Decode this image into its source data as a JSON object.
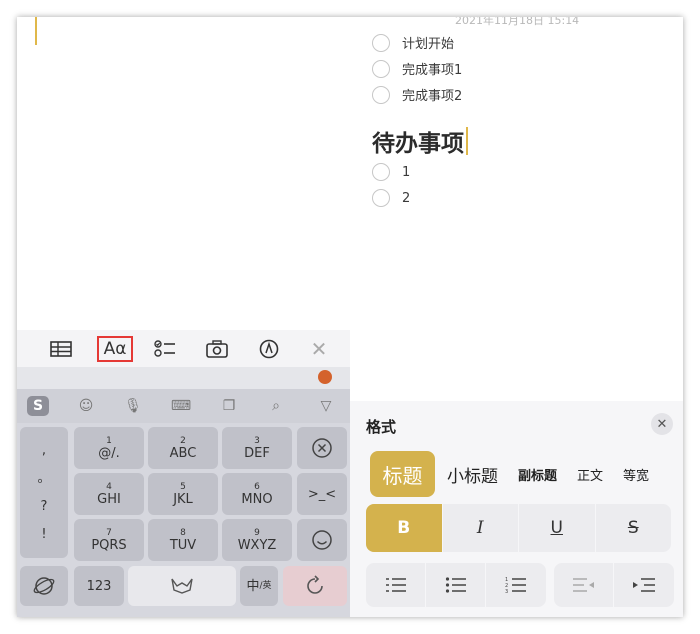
{
  "note": {
    "date": "2021年11月18日 15:14",
    "checklist_top": [
      "计划开始",
      "完成事项1",
      "完成事项2"
    ],
    "heading": "待办事项",
    "checklist_bottom": [
      "1",
      "2"
    ]
  },
  "toolbar": {
    "items": [
      "table-icon",
      "format-icon",
      "checklist-icon",
      "camera-icon",
      "markup-icon",
      "close-icon"
    ],
    "format_label": "Aα",
    "close_label": "✕"
  },
  "keyboard": {
    "left_col": [
      ",",
      "。",
      "?",
      "!"
    ],
    "keys": [
      {
        "top": "1",
        "main": "@/."
      },
      {
        "top": "2",
        "main": "ABC"
      },
      {
        "top": "3",
        "main": "DEF"
      },
      {
        "top": "4",
        "main": "GHI"
      },
      {
        "top": "5",
        "main": "JKL"
      },
      {
        "top": "6",
        "main": "MNO"
      },
      {
        "top": "7",
        "main": "PQRS"
      },
      {
        "top": "8",
        "main": "TUV"
      },
      {
        "top": "9",
        "main": "WXYZ"
      }
    ],
    "num_key": "123",
    "lang_key": "中",
    "lang_sub": "/英"
  },
  "format_panel": {
    "title": "格式",
    "close": "✕",
    "styles": [
      "标题",
      "小标题",
      "副标题",
      "正文",
      "等宽"
    ],
    "text_styles": [
      "B",
      "I",
      "U",
      "S"
    ]
  },
  "colors": {
    "accent": "#d4b24d",
    "highlight_box": "#e53935"
  }
}
